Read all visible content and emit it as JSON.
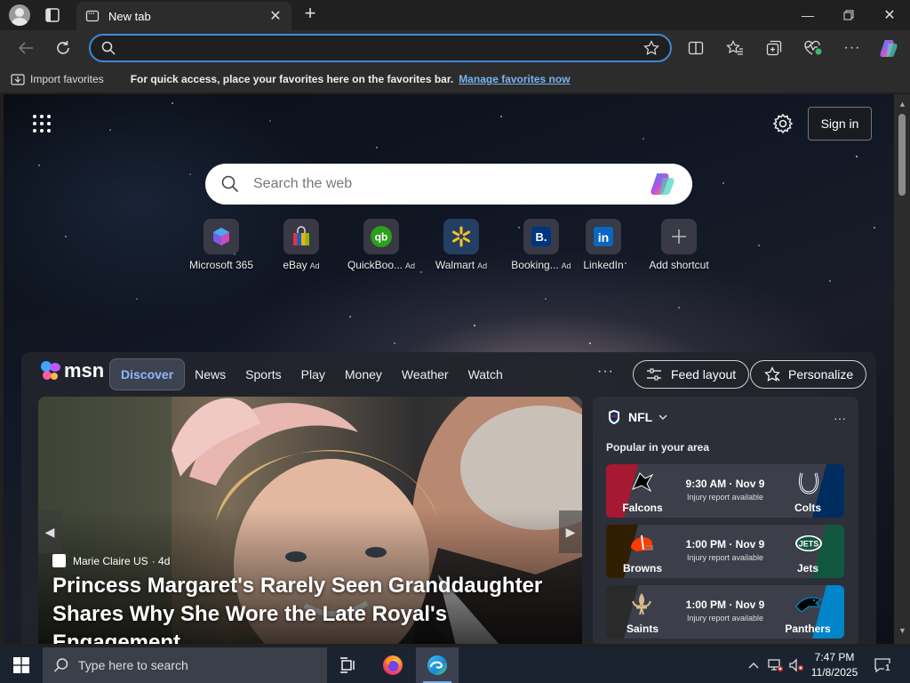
{
  "browser": {
    "tab_title": "New tab",
    "address_value": "",
    "favorites_bar": {
      "import_label": "Import favorites",
      "message": "For quick access, place your favorites here on the favorites bar.",
      "manage_link": "Manage favorites now"
    }
  },
  "newtab": {
    "signin_label": "Sign in",
    "search_placeholder": "Search the web",
    "shortcuts": [
      {
        "label": "Microsoft 365",
        "ad": ""
      },
      {
        "label": "eBay",
        "ad": "Ad"
      },
      {
        "label": "QuickBoo...",
        "ad": "Ad"
      },
      {
        "label": "Walmart",
        "ad": "Ad"
      },
      {
        "label": "Booking...",
        "ad": "Ad"
      },
      {
        "label": "LinkedIn",
        "ad": ""
      },
      {
        "label": "Add shortcut",
        "ad": ""
      }
    ],
    "msn": {
      "logo_text": "msn",
      "tabs": [
        "Discover",
        "News",
        "Sports",
        "Play",
        "Money",
        "Weather",
        "Watch"
      ],
      "more": "···",
      "feed_layout": "Feed layout",
      "personalize": "Personalize"
    },
    "hero": {
      "source": "Marie Claire US",
      "age": "· 4d",
      "headline": "Princess Margaret's Rarely Seen Granddaughter Shares Why She Wore the Late Royal's Engagement…"
    },
    "nfl": {
      "title": "NFL",
      "subtitle": "Popular in your area",
      "games": [
        {
          "team1": "Falcons",
          "team2": "Colts",
          "time": "9:30 AM · Nov 9",
          "note": "Injury report available",
          "c1": "#a71930",
          "c2": "#002c5f"
        },
        {
          "team1": "Browns",
          "team2": "Jets",
          "time": "1:00 PM · Nov 9",
          "note": "Injury report available",
          "c1": "#311d00",
          "c2": "#125740"
        },
        {
          "team1": "Saints",
          "team2": "Panthers",
          "time": "1:00 PM · Nov 9",
          "note": "Injury report available",
          "c1": "#2a2a2a",
          "c2": "#0085ca"
        }
      ]
    }
  },
  "taskbar": {
    "search_placeholder": "Type here to search",
    "time": "7:47 PM",
    "date": "11/8/2025",
    "notification_count": "1"
  }
}
